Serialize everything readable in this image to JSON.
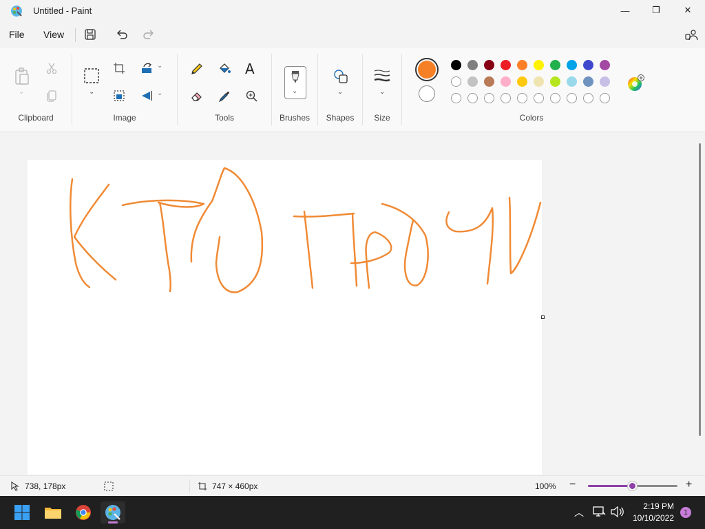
{
  "window": {
    "title": "Untitled - Paint",
    "minimize_glyph": "—",
    "maximize_glyph": "❐",
    "close_glyph": "✕"
  },
  "menu": {
    "file": "File",
    "view": "View"
  },
  "ribbon": {
    "groups": {
      "clipboard": "Clipboard",
      "image": "Image",
      "tools": "Tools",
      "brushes": "Brushes",
      "shapes": "Shapes",
      "size": "Size",
      "colors": "Colors"
    },
    "primary_color": "#f58025",
    "secondary_color": "#ffffff",
    "palette_row1": [
      "#000000",
      "#7f7f7f",
      "#880015",
      "#ed1c24",
      "#ff7f27",
      "#fff200",
      "#22b14c",
      "#00a2e8",
      "#3f48cc",
      "#a349a4"
    ],
    "palette_row2": [
      "#ffffff",
      "#c3c3c3",
      "#b97a57",
      "#ffaec9",
      "#ffc90e",
      "#efe4b0",
      "#b5e61d",
      "#99d9ea",
      "#7092be",
      "#c8bfe7"
    ],
    "palette_row3": [
      "",
      "",
      "",
      "",
      "",
      "",
      "",
      "",
      "",
      ""
    ]
  },
  "canvas": {
    "stroke_color": "#f08a35"
  },
  "status": {
    "cursor_position": "738, 178px",
    "canvas_size": "747 × 460px",
    "zoom": "100%",
    "zoom_level": 0.5
  },
  "taskbar": {
    "time": "2:19 PM",
    "date": "10/10/2022",
    "notification_count": "1"
  }
}
